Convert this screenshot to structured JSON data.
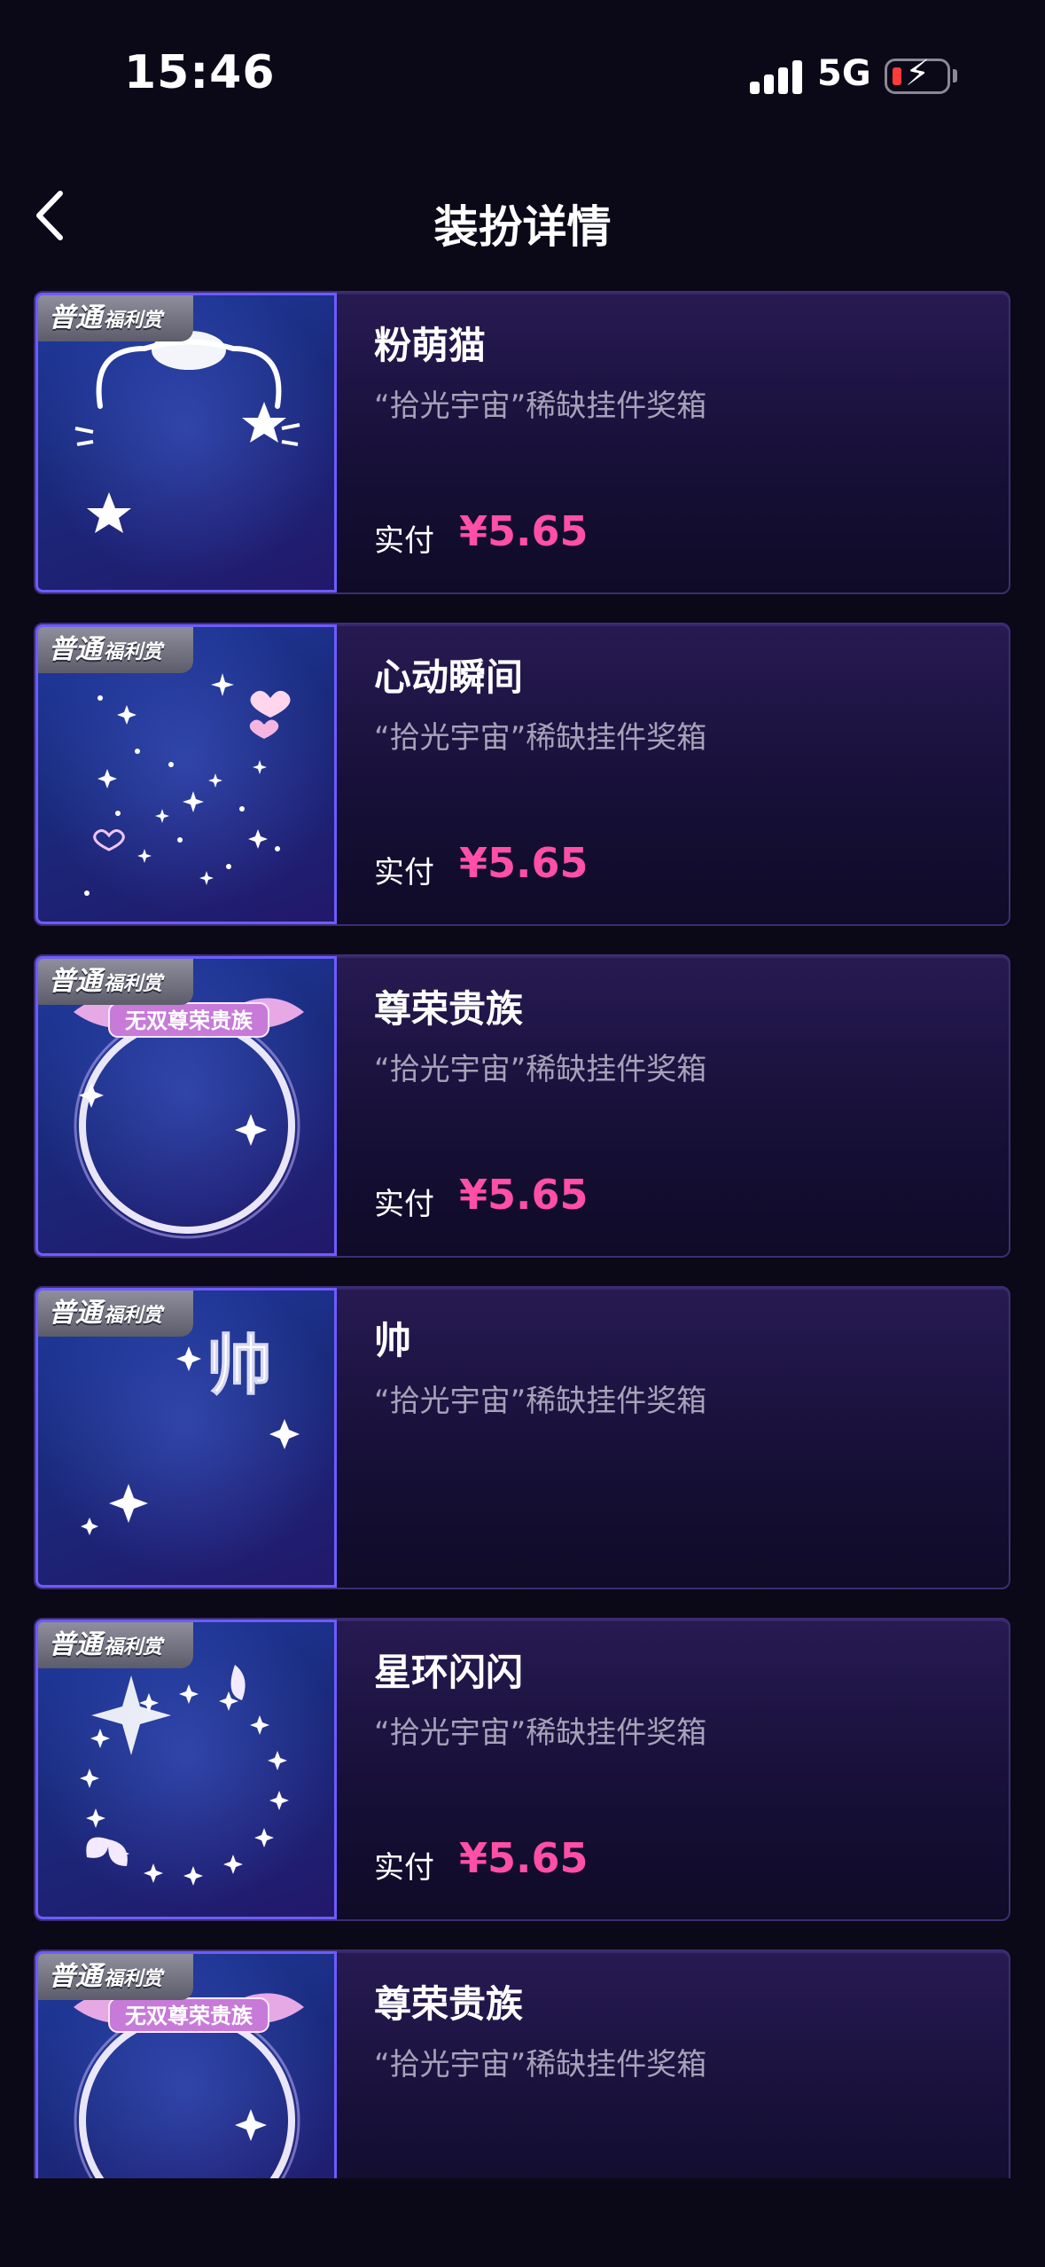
{
  "status_bar": {
    "time": "15:46",
    "network": "5G"
  },
  "nav": {
    "title": "装扮详情"
  },
  "items": [
    {
      "tag_main": "普通",
      "tag_sub": "福利赏",
      "name": "粉萌猫",
      "source": "“拾光宇宙”稀缺挂件奖箱",
      "paid_label": "实付",
      "price": "¥5.65",
      "icon": "cat-frame-icon"
    },
    {
      "tag_main": "普通",
      "tag_sub": "福利赏",
      "name": "心动瞬间",
      "source": "“拾光宇宙”稀缺挂件奖箱",
      "paid_label": "实付",
      "price": "¥5.65",
      "icon": "sparkle-hearts-icon"
    },
    {
      "tag_main": "普通",
      "tag_sub": "福利赏",
      "name": "尊荣贵族",
      "source": "“拾光宇宙”稀缺挂件奖箱",
      "paid_label": "实付",
      "price": "¥5.65",
      "icon": "noble-ring-icon",
      "badge_text": "无双尊荣贵族"
    },
    {
      "tag_main": "普通",
      "tag_sub": "福利赏",
      "name": "帅",
      "source": "“拾光宇宙”稀缺挂件奖箱",
      "paid_label": "",
      "price": "",
      "icon": "handsome-text-icon",
      "art_text": "帅"
    },
    {
      "tag_main": "普通",
      "tag_sub": "福利赏",
      "name": "星环闪闪",
      "source": "“拾光宇宙”稀缺挂件奖箱",
      "paid_label": "实付",
      "price": "¥5.65",
      "icon": "star-ring-icon"
    },
    {
      "tag_main": "普通",
      "tag_sub": "福利赏",
      "name": "尊荣贵族",
      "source": "“拾光宇宙”稀缺挂件奖箱",
      "paid_label": "",
      "price": "",
      "icon": "noble-ring-icon",
      "badge_text": "无双尊荣贵族"
    }
  ],
  "colors": {
    "accent_price": "#ff4fa6",
    "background": "#0b0818",
    "card_border": "#3d2d72"
  }
}
